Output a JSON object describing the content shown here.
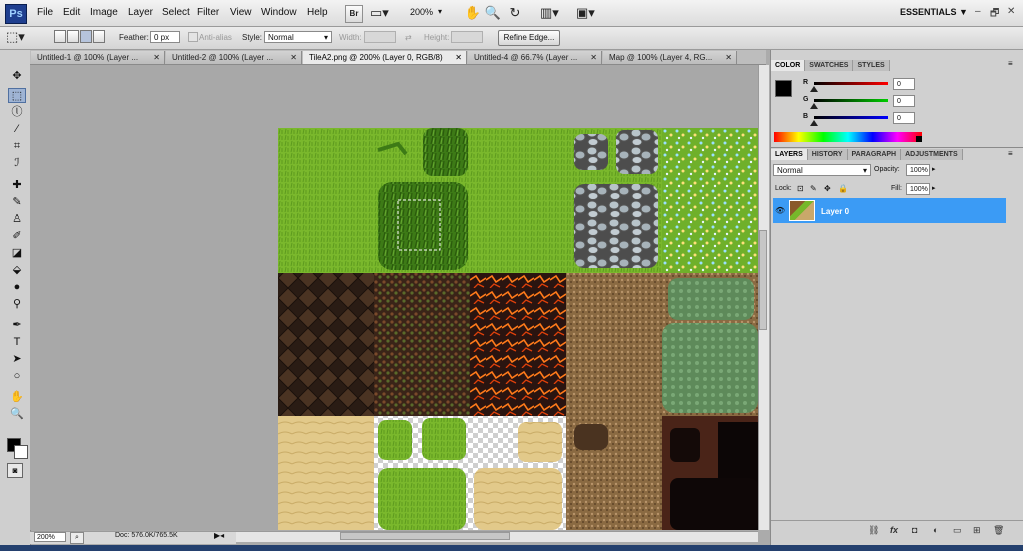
{
  "app": {
    "logo": "Ps",
    "workspace": "ESSENTIALS ▼",
    "win_controls": [
      "–",
      "🗗",
      "✕"
    ]
  },
  "menu": [
    "File",
    "Edit",
    "Image",
    "Layer",
    "Select",
    "Filter",
    "View",
    "Window",
    "Help"
  ],
  "app_bar": {
    "bridge_label": "Br",
    "zoom": "200%"
  },
  "options": {
    "feather_label": "Feather:",
    "feather_value": "0 px",
    "antialias_label": "Anti-alias",
    "style_label": "Style:",
    "style_value": "Normal",
    "width_label": "Width:",
    "height_label": "Height:",
    "refine_edge": "Refine Edge..."
  },
  "tabs": [
    {
      "label": "Untitled-1 @ 100% (Layer ..."
    },
    {
      "label": "Untitled-2 @ 100% (Layer ..."
    },
    {
      "label": "TileA2.png @ 200% (Layer 0, RGB/8)"
    },
    {
      "label": "Untitled-4 @ 66.7% (Layer ..."
    },
    {
      "label": "Map @ 100% (Layer 4, RG..."
    }
  ],
  "tools": [
    "move-icon",
    "marquee-icon",
    "lasso-icon",
    "quick-select-icon",
    "crop-icon",
    "eyedropper-icon",
    "healing-icon",
    "brush-icon",
    "stamp-icon",
    "history-brush-icon",
    "eraser-icon",
    "paint-bucket-icon",
    "blur-icon",
    "dodge-icon",
    "pen-icon",
    "type-icon",
    "path-select-icon",
    "shape-icon",
    "hand-icon",
    "zoom-icon"
  ],
  "tool_glyphs": [
    "✥",
    "⬚",
    "ⓛ",
    "⁄",
    "⌗",
    "ℐ",
    "✚",
    "✎",
    "♙",
    "✐",
    "◪",
    "⬙",
    "●",
    "⚲",
    "✒",
    "T",
    "➤",
    "○",
    "✋",
    "🔍"
  ],
  "status": {
    "zoom": "200%",
    "doc": "Doc: 576.0K/765.5K"
  },
  "color_panel": {
    "tabs": [
      "COLOR",
      "SWATCHES",
      "STYLES"
    ],
    "channels": [
      {
        "label": "R",
        "value": "0",
        "color": "#d00000"
      },
      {
        "label": "G",
        "value": "0",
        "color": "#00a000"
      },
      {
        "label": "B",
        "value": "0",
        "color": "#0000c0"
      }
    ]
  },
  "layers_panel": {
    "tabs": [
      "LAYERS",
      "HISTORY",
      "PARAGRAPH",
      "ADJUSTMENTS"
    ],
    "blend_mode": "Normal",
    "opacity_label": "Opacity:",
    "opacity_value": "100%",
    "lock_label": "Lock:",
    "fill_label": "Fill:",
    "fill_value": "100%",
    "layer_name": "Layer 0",
    "bottom_icons": [
      "⛓",
      "fx",
      "◘",
      "◐",
      "▭",
      "⊞",
      "🗑"
    ]
  }
}
